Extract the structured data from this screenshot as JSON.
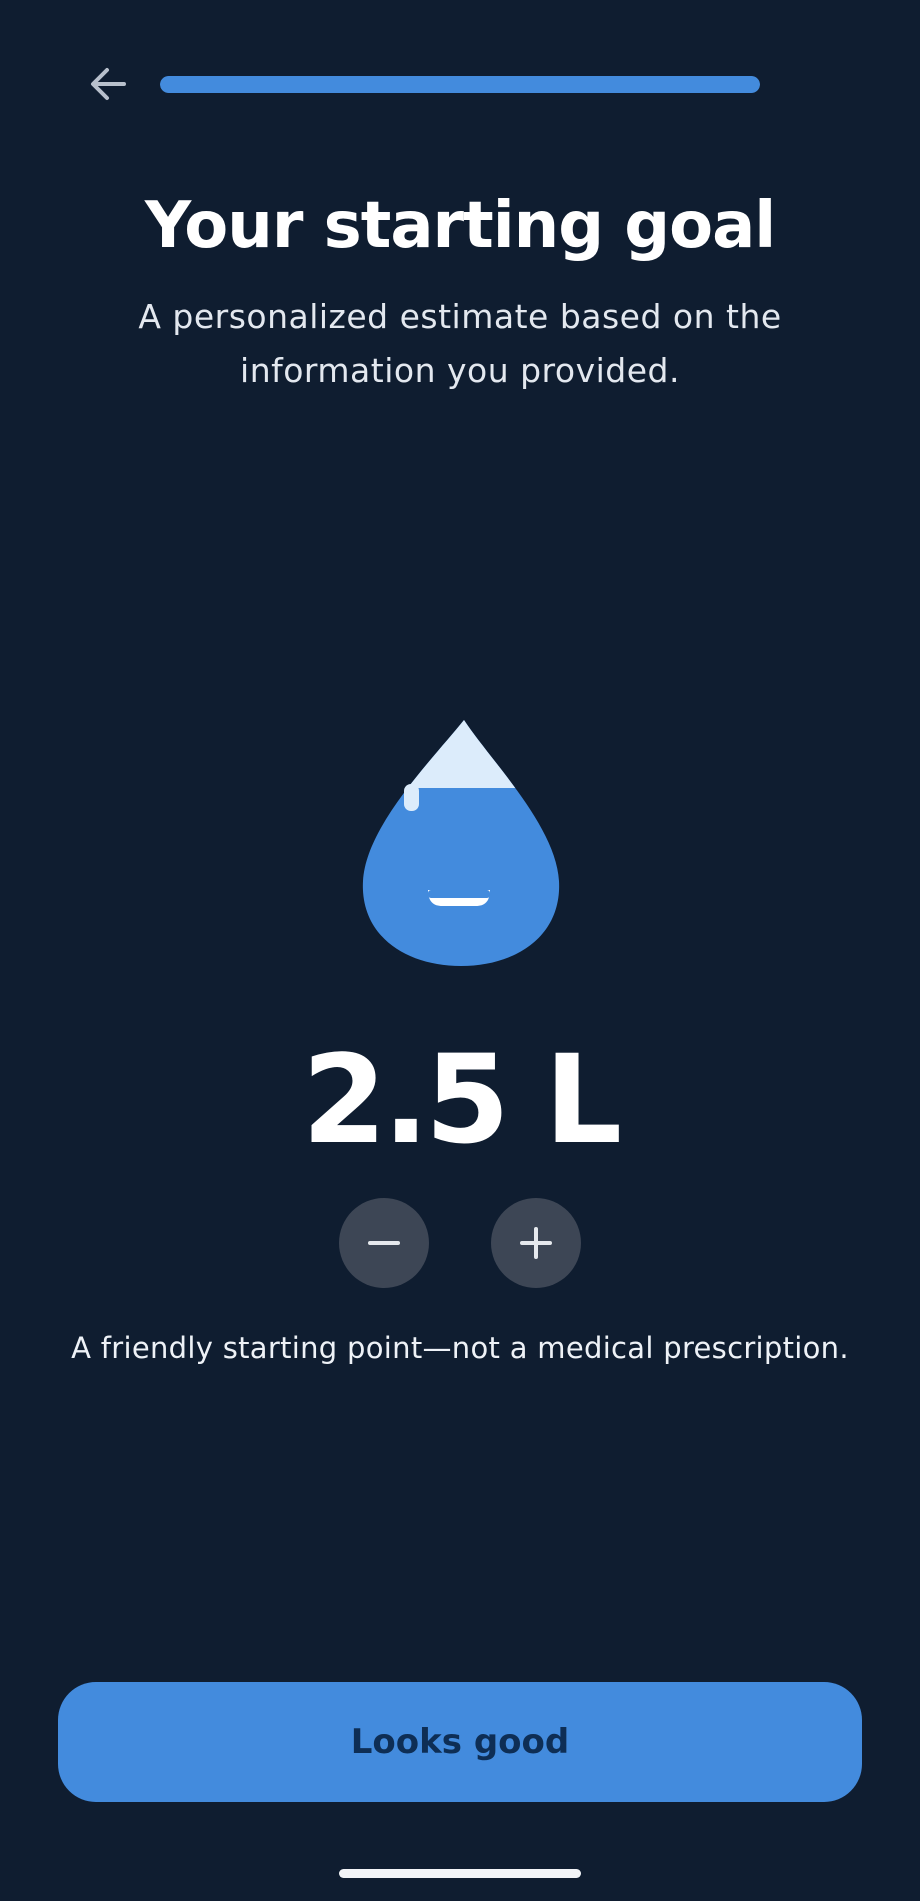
{
  "header": {
    "back_icon": "arrow-left-icon",
    "progress_fraction": 1.0,
    "colors": {
      "background": "#0f1d30",
      "accent": "#438bdd"
    }
  },
  "content": {
    "title": "Your starting goal",
    "subtitle": "A personalized estimate based on the information you provided.",
    "mascot_icon": "water-drop-mascot-icon",
    "goal_value": "2.5 L",
    "decrease_icon": "minus-icon",
    "increase_icon": "plus-icon",
    "disclaimer": "A friendly starting point—not a medical prescription."
  },
  "footer": {
    "cta_label": "Looks good"
  }
}
